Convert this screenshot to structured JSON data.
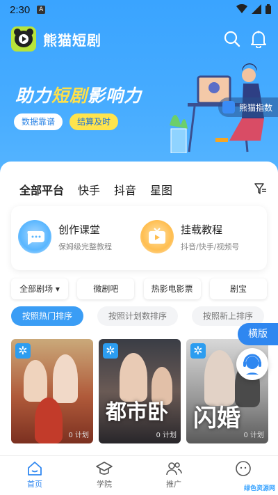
{
  "status_bar": {
    "time": "2:30",
    "notif_letter": "A"
  },
  "header": {
    "app_name": "熊猫短剧",
    "icons": [
      "search-icon",
      "bell-icon"
    ]
  },
  "banner": {
    "title_pre": "助力",
    "title_hl": "短剧",
    "title_post": "影响力",
    "tags": [
      "数据靠谱",
      "结算及时"
    ],
    "side_link": "熊猫指数",
    "colors": {
      "bg": "#3aa4ff",
      "highlight": "#ffe04a"
    }
  },
  "platform_tabs": [
    "全部平台",
    "快手",
    "抖音",
    "星图"
  ],
  "courses": [
    {
      "title": "创作课堂",
      "subtitle": "保姆级完整教程",
      "icon": "chat-bubble-icon"
    },
    {
      "title": "挂载教程",
      "subtitle": "抖音/快手/视频号",
      "icon": "tv-icon"
    }
  ],
  "genres": [
    {
      "label": "全部剧场",
      "dropdown": true
    },
    {
      "label": "微剧吧"
    },
    {
      "label": "热影电影票"
    },
    {
      "label": "剧宝"
    }
  ],
  "sorts": [
    "按照热门排序",
    "按照计划数排序",
    "按照新上排序"
  ],
  "dramas": [
    {
      "plan_count": "0 计划",
      "poster_text": ""
    },
    {
      "plan_count": "0 计划",
      "poster_text": "都市卧"
    },
    {
      "plan_count": "0 计划",
      "poster_text": "闪婚"
    }
  ],
  "floating": {
    "landscape": "横版"
  },
  "nav": [
    {
      "label": "首页",
      "icon": "home-icon",
      "active": true
    },
    {
      "label": "学院",
      "icon": "graduation-cap-icon"
    },
    {
      "label": "推广",
      "icon": "users-icon"
    },
    {
      "label": "",
      "icon": "smiley-icon"
    }
  ],
  "watermark": "绿色资源网"
}
